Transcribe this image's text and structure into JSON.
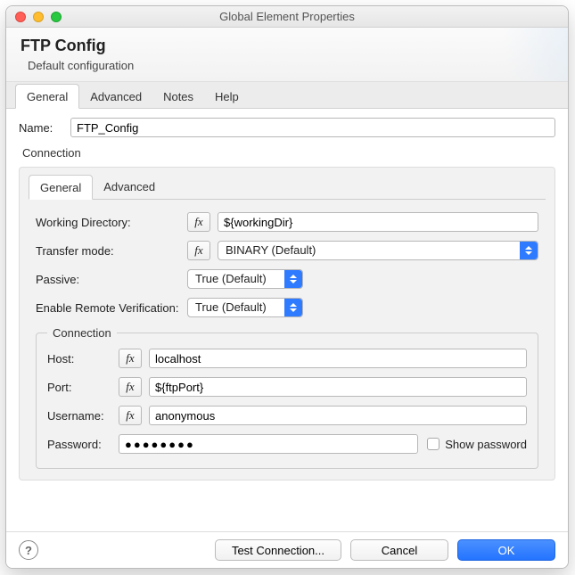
{
  "window": {
    "title": "Global Element Properties"
  },
  "header": {
    "title": "FTP Config",
    "subtitle": "Default configuration"
  },
  "outer_tabs": [
    "General",
    "Advanced",
    "Notes",
    "Help"
  ],
  "name_field": {
    "label": "Name:",
    "value": "FTP_Config"
  },
  "connection_label": "Connection",
  "inner_tabs": [
    "General",
    "Advanced"
  ],
  "config": {
    "working_dir": {
      "label": "Working Directory:",
      "value": "${workingDir}"
    },
    "transfer_mode": {
      "label": "Transfer mode:",
      "value": "BINARY (Default)"
    },
    "passive": {
      "label": "Passive:",
      "value": "True (Default)"
    },
    "remote_verify": {
      "label": "Enable Remote Verification:",
      "value": "True (Default)"
    }
  },
  "conn": {
    "legend": "Connection",
    "host": {
      "label": "Host:",
      "value": "localhost"
    },
    "port": {
      "label": "Port:",
      "value": "${ftpPort}"
    },
    "username": {
      "label": "Username:",
      "value": "anonymous"
    },
    "password": {
      "label": "Password:",
      "value": "●●●●●●●●"
    },
    "show_password_label": "Show password"
  },
  "footer": {
    "test": "Test Connection...",
    "cancel": "Cancel",
    "ok": "OK"
  },
  "fx_label": "fx"
}
